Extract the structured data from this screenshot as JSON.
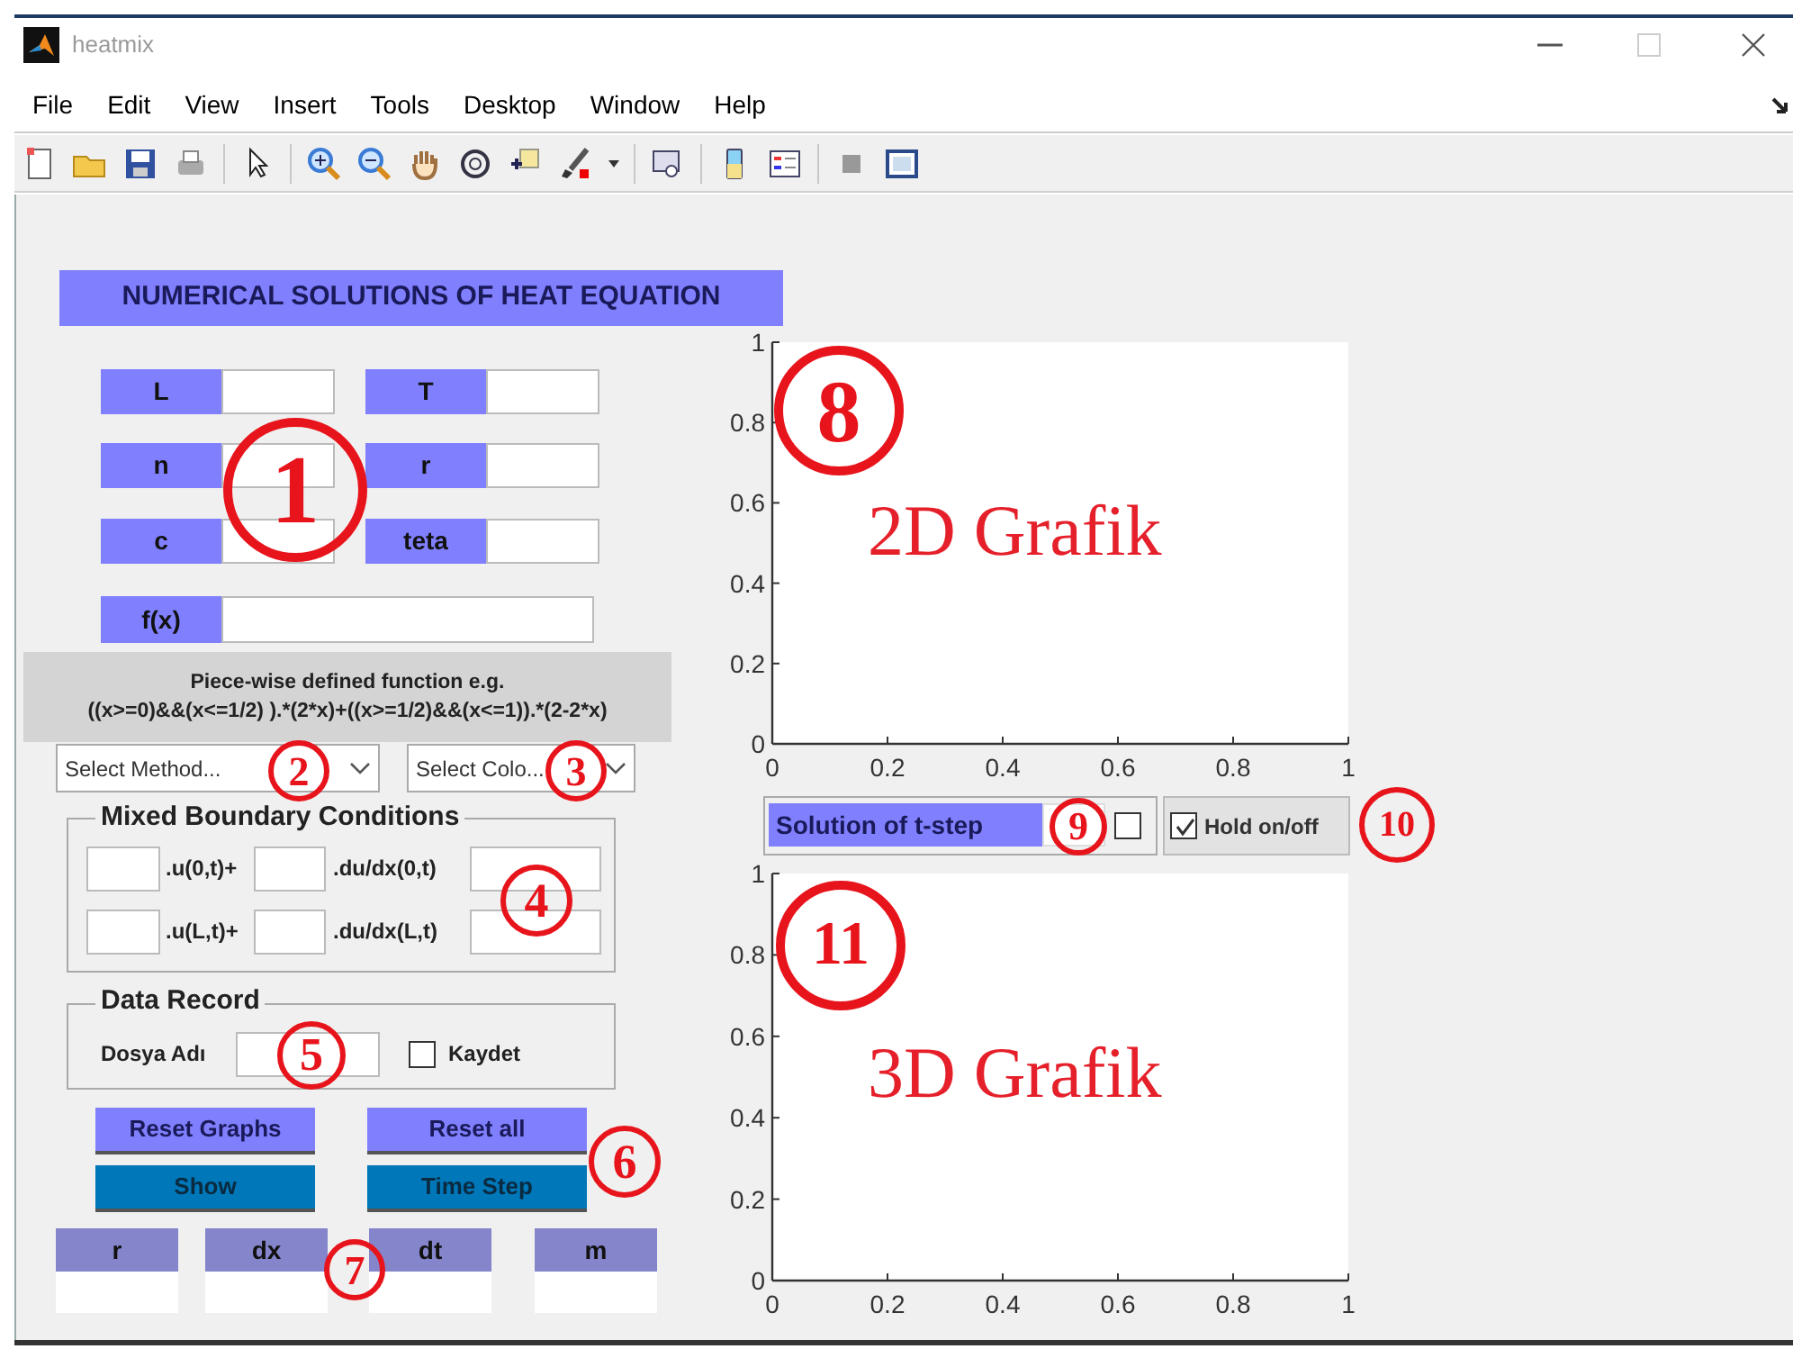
{
  "window": {
    "title": "heatmix"
  },
  "menu": [
    "File",
    "Edit",
    "View",
    "Insert",
    "Tools",
    "Desktop",
    "Window",
    "Help"
  ],
  "heading": "NUMERICAL SOLUTIONS OF HEAT EQUATION",
  "parameters": [
    {
      "label": "L"
    },
    {
      "label": "T"
    },
    {
      "label": "n"
    },
    {
      "label": "r"
    },
    {
      "label": "c"
    },
    {
      "label": "teta"
    }
  ],
  "function_field": {
    "label": "f(x)"
  },
  "hint": [
    "Piece-wise defined function e.g.",
    "((x>=0)&&(x<=1/2) ).*(2*x)+((x>=1/2)&&(x<=1)).*(2-2*x)"
  ],
  "dropdowns": [
    {
      "value": "Select Method..."
    },
    {
      "value": "Select Colo..."
    }
  ],
  "boundary_group": {
    "title": "Mixed Boundary Conditions",
    "rows": [
      {
        "term_1": ".u(0,t)+",
        "term_2": ".du/dx(0,t)"
      },
      {
        "term_1": ".u(L,t)+",
        "term_2": ".du/dx(L,t)"
      }
    ]
  },
  "data_record": {
    "title": "Data Record",
    "file_label": "Dosya Adı",
    "save": {
      "label": "Kaydet",
      "checked": false
    }
  },
  "buttons": [
    {
      "label": "Reset Graphs",
      "kind": "light"
    },
    {
      "label": "Reset all",
      "kind": "light"
    },
    {
      "label": "Show",
      "kind": "dark"
    },
    {
      "label": "Time Step",
      "kind": "dark"
    }
  ],
  "outputs": [
    {
      "label": "r"
    },
    {
      "label": "dx"
    },
    {
      "label": "dt"
    },
    {
      "label": "m"
    }
  ],
  "plot_2d": {
    "overlay": "2D Grafik",
    "chart_data": {
      "type": "line",
      "xlim": [
        0,
        1
      ],
      "ylim": [
        0,
        1
      ],
      "xticks": [
        0,
        0.2,
        0.4,
        0.6,
        0.8,
        1
      ],
      "yticks": [
        0,
        0.2,
        0.4,
        0.6,
        0.8,
        1
      ]
    }
  },
  "t_step": {
    "label": "Solution of t-step",
    "checked": false
  },
  "hold": {
    "label": "Hold on/off",
    "checked": true
  },
  "plot_3d": {
    "overlay": "3D Grafik",
    "chart_data": {
      "type": "line",
      "xlim": [
        0,
        1
      ],
      "ylim": [
        0,
        1
      ],
      "xticks": [
        0,
        0.2,
        0.4,
        0.6,
        0.8,
        1
      ],
      "yticks": [
        0,
        0.2,
        0.4,
        0.6,
        0.8,
        1
      ]
    }
  },
  "callouts": [
    "1",
    "2",
    "3",
    "4",
    "5",
    "6",
    "7",
    "8",
    "9",
    "10",
    "11"
  ]
}
